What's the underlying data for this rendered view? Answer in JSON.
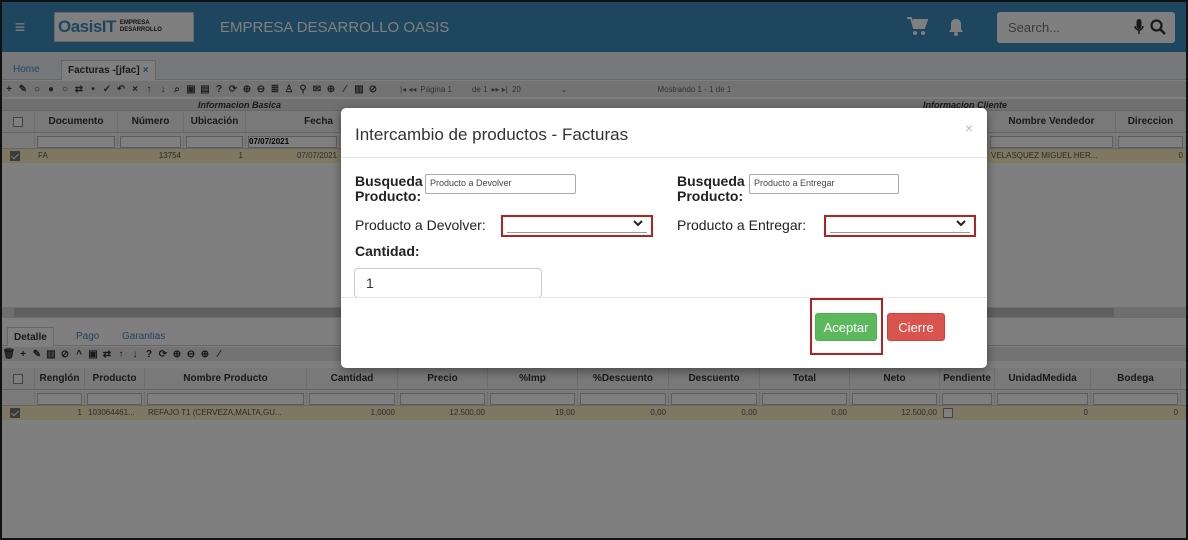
{
  "header": {
    "menu_icon": "hamburger-icon",
    "logo_text_main": "OasisIT",
    "logo_text_sub1": "EMPRESA",
    "logo_text_sub2": "DESARROLLO",
    "app_title": "EMPRESA DESARROLLO OASIS",
    "search_placeholder": "Search...",
    "colors": {
      "bar": "#3c8dbc",
      "logo_green": "#6cbe45"
    }
  },
  "tabs": [
    {
      "label": "Home"
    },
    {
      "label": "Facturas -[jfac]",
      "close": "×"
    }
  ],
  "toolbar": {
    "page_label": "Página 1",
    "page_of": "de 1",
    "page_size": "20",
    "showing": "Mostrando 1 - 1 de 1"
  },
  "main_grid": {
    "group_left": "Informacion Basica",
    "group_right": "Informacion Cliente",
    "columns": [
      "Documento",
      "Número",
      "Ubicación",
      "Fecha",
      "Nombre Vendedor",
      "Direccion"
    ],
    "filter_fecha": "07/07/2021",
    "row": {
      "documento": "FA",
      "numero": "13754",
      "ubicacion": "1",
      "fecha": "07/07/2021",
      "vendedor": "VELASQUEZ MIGUEL HER...",
      "direccion": "0"
    }
  },
  "detail_tabs": [
    "Detalle",
    "Pago",
    "Garantias"
  ],
  "detail_grid": {
    "columns": [
      "Renglón",
      "Producto",
      "Nombre Producto",
      "Cantidad",
      "Precio",
      "%Imp",
      "%Descuento",
      "Descuento",
      "Total",
      "Neto",
      "Pendiente",
      "UnidadMedida",
      "Bodega"
    ],
    "row": {
      "renglon": "1",
      "producto": "103064461...",
      "nombre": "REFAJO T1 (CERVEZA,MALTA,GU...",
      "cantidad": "1,0000",
      "precio": "12.500,00",
      "imp": "19,00",
      "pdesc": "0,00",
      "desc": "0,00",
      "total": "0,00",
      "neto": "12.500,00",
      "unidad": "0",
      "bodega": "0"
    }
  },
  "modal": {
    "title": "Intercambio de productos - Facturas",
    "close": "×",
    "busqueda_label_1": "Busqueda",
    "busqueda_label_2": "Producto:",
    "search_devolver_placeholder": "Producto a Devolver",
    "search_entregar_placeholder": "Producto a Entregar",
    "devolver_label": "Producto a Devolver:",
    "entregar_label": "Producto a Entregar:",
    "cantidad_label": "Cantidad:",
    "cantidad_value": "1",
    "accept_label": "Aceptar",
    "close_label": "Cierre",
    "colors": {
      "accept": "#5cb85c",
      "close": "#d9534f",
      "highlight": "#b22222"
    }
  }
}
